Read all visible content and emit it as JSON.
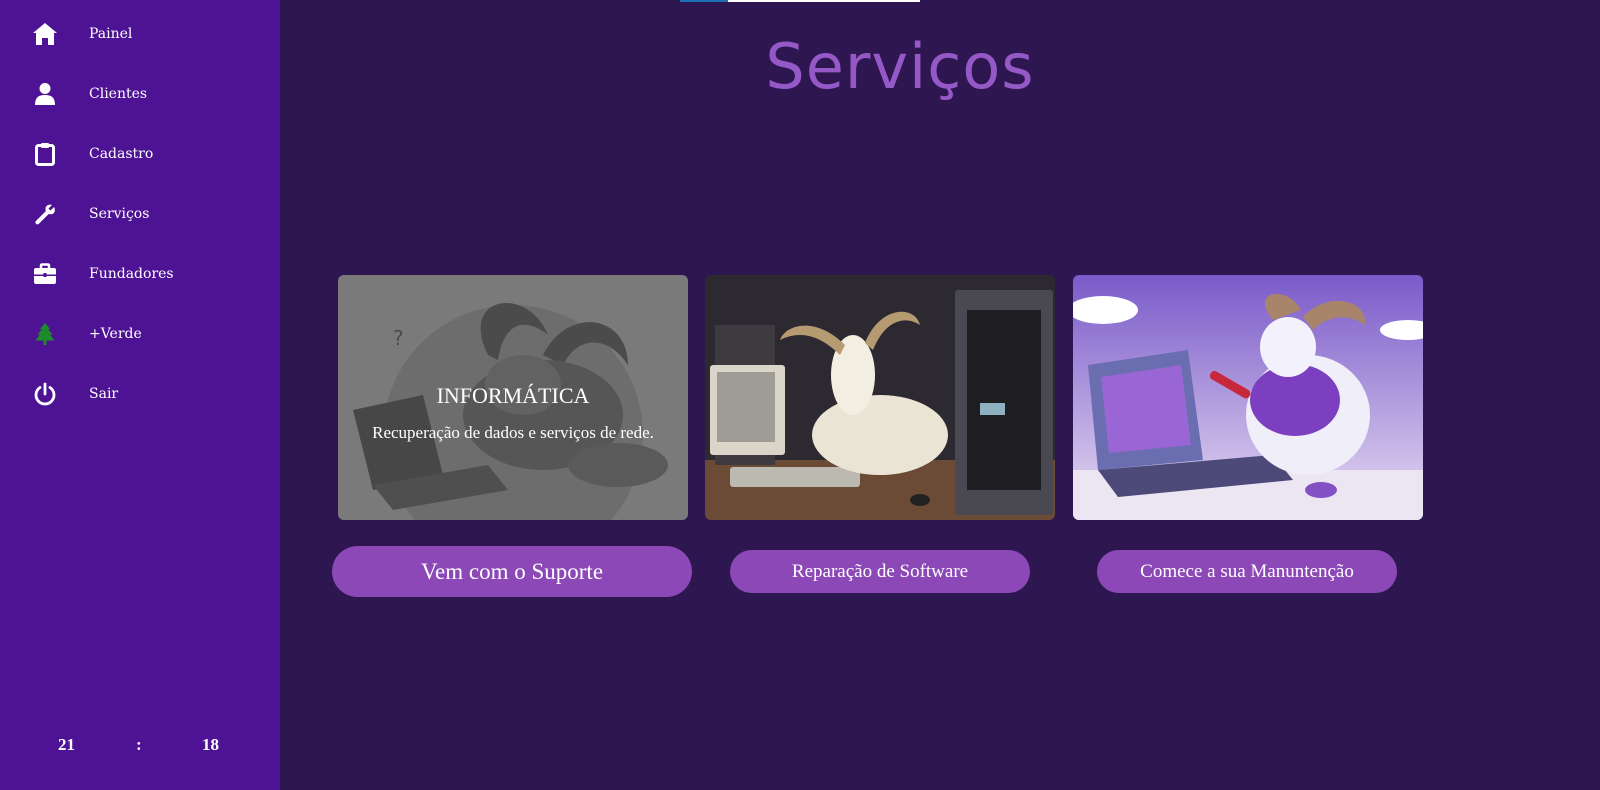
{
  "sidebar": {
    "items": [
      {
        "label": "Painel",
        "icon": "home-icon"
      },
      {
        "label": "Clientes",
        "icon": "user-icon"
      },
      {
        "label": "Cadastro",
        "icon": "clipboard-icon"
      },
      {
        "label": "Serviços",
        "icon": "wrench-icon"
      },
      {
        "label": "Fundadores",
        "icon": "briefcase-icon"
      },
      {
        "label": "+Verde",
        "icon": "tree-icon"
      },
      {
        "label": "Sair",
        "icon": "power-icon"
      }
    ],
    "clock": {
      "hours": "21",
      "separator": ":",
      "minutes": "18"
    }
  },
  "main": {
    "title": "Serviços",
    "cards": [
      {
        "image": "goat-at-laptop-illustration",
        "overlay_title": "INFORMÁTICA",
        "overlay_subtitle": "Recuperação de dados e serviços de rede."
      },
      {
        "image": "goat-with-computer-tower-illustration"
      },
      {
        "image": "goat-repairing-computer-illustration"
      }
    ],
    "buttons": [
      {
        "label": "Vem com o Suporte"
      },
      {
        "label": "Reparação de Software"
      },
      {
        "label": "Comece a sua Manuntenção"
      }
    ]
  },
  "colors": {
    "sidebar_bg": "#4e1394",
    "main_bg": "#2e1650",
    "title": "#9559c7",
    "button_bg": "#8b48b6",
    "tree_icon": "#1e8a2e"
  }
}
